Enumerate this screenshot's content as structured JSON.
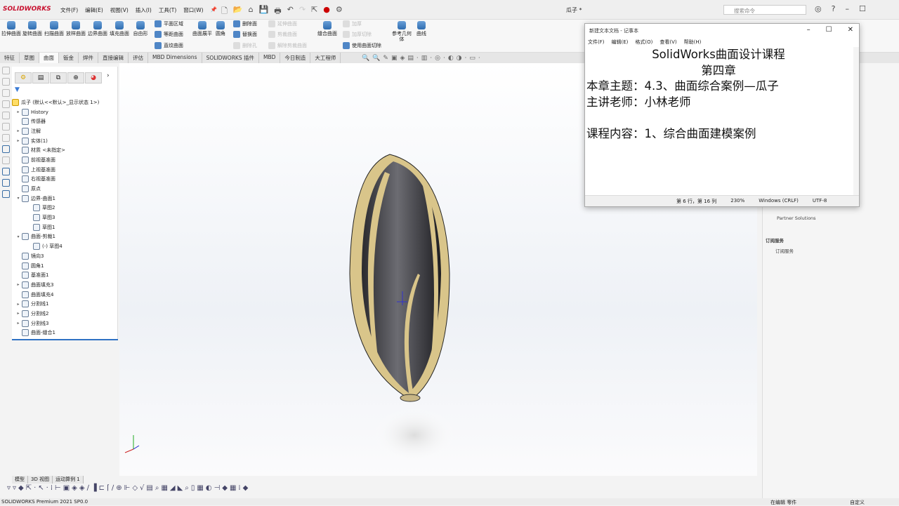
{
  "app": {
    "logo": "SOLIDWORKS",
    "doc_title": "瓜子 *",
    "search_placeholder": "搜索命令"
  },
  "menu": [
    "文件(F)",
    "编辑(E)",
    "视图(V)",
    "插入(I)",
    "工具(T)",
    "窗口(W)"
  ],
  "ribbon": {
    "large": [
      "拉伸曲面",
      "旋转曲面",
      "扫描曲面",
      "放样曲面",
      "边界曲面",
      "填充曲面",
      "自由形",
      "曲面展平",
      "圆角",
      "缝合曲面",
      "参考几何体",
      "曲线"
    ],
    "small": [
      "平面区域",
      "等距曲面",
      "直纹曲面",
      "删除面",
      "替换面",
      "删除孔",
      "延伸曲面",
      "剪裁曲面",
      "解除剪裁曲面",
      "加厚",
      "加厚切除",
      "使用曲面切除"
    ]
  },
  "tabs": [
    "特征",
    "草图",
    "曲面",
    "钣金",
    "焊件",
    "直接编辑",
    "评估",
    "MBD Dimensions",
    "SOLIDWORKS 插件",
    "MBD",
    "今日制造",
    "大工程师"
  ],
  "active_tab": "曲面",
  "tree": {
    "root": "瓜子 (默认<<默认>_显示状态 1>)",
    "nodes": [
      {
        "label": "History",
        "level": 1,
        "exp": "▸"
      },
      {
        "label": "传感器",
        "level": 1,
        "exp": ""
      },
      {
        "label": "注解",
        "level": 1,
        "exp": "▸"
      },
      {
        "label": "实体(1)",
        "level": 1,
        "exp": "▸"
      },
      {
        "label": "材质 <未指定>",
        "level": 1,
        "exp": ""
      },
      {
        "label": "前视基准面",
        "level": 1,
        "exp": ""
      },
      {
        "label": "上视基准面",
        "level": 1,
        "exp": ""
      },
      {
        "label": "右视基准面",
        "level": 1,
        "exp": ""
      },
      {
        "label": "原点",
        "level": 1,
        "exp": ""
      },
      {
        "label": "边界-曲面1",
        "level": 1,
        "exp": "▾"
      },
      {
        "label": "草图2",
        "level": 2,
        "exp": ""
      },
      {
        "label": "草图3",
        "level": 2,
        "exp": ""
      },
      {
        "label": "草图1",
        "level": 2,
        "exp": ""
      },
      {
        "label": "曲面-剪裁1",
        "level": 1,
        "exp": "▾"
      },
      {
        "label": "(-) 草图4",
        "level": 2,
        "exp": ""
      },
      {
        "label": "镜向3",
        "level": 1,
        "exp": ""
      },
      {
        "label": "圆角1",
        "level": 1,
        "exp": ""
      },
      {
        "label": "基准面1",
        "level": 1,
        "exp": ""
      },
      {
        "label": "曲面填充3",
        "level": 1,
        "exp": "▸"
      },
      {
        "label": "曲面填充4",
        "level": 1,
        "exp": ""
      },
      {
        "label": "分割线1",
        "level": 1,
        "exp": "▸"
      },
      {
        "label": "分割线2",
        "level": 1,
        "exp": "▸"
      },
      {
        "label": "分割线3",
        "level": 1,
        "exp": "▸"
      },
      {
        "label": "曲面-缝合1",
        "level": 1,
        "exp": ""
      }
    ]
  },
  "notepad": {
    "title": "新建文本文档 - 记事本",
    "menu": [
      "文件(F)",
      "编辑(E)",
      "格式(O)",
      "查看(V)",
      "帮助(H)"
    ],
    "lines": [
      "SolidWorks曲面设计课程",
      "第四章",
      "本章主题：4.3、曲面综合案例—瓜子",
      "主讲老师：小林老师",
      "",
      "课程内容：1、综合曲面建模案例"
    ],
    "status": {
      "pos": "第 6 行，第 16 列",
      "zoom": "230%",
      "eol": "Windows (CRLF)",
      "enc": "UTF-8"
    }
  },
  "taskpane": {
    "partner": "Partner Solutions",
    "sub_header": "订阅服务",
    "sub_item": "订阅服务"
  },
  "bottom_tabs": [
    "模型",
    "3D 视图",
    "运动算例 1"
  ],
  "status": {
    "left": "SOLIDWORKS Premium 2021 SP0.0",
    "mode": "在编辑 零件",
    "custom": "自定义"
  }
}
